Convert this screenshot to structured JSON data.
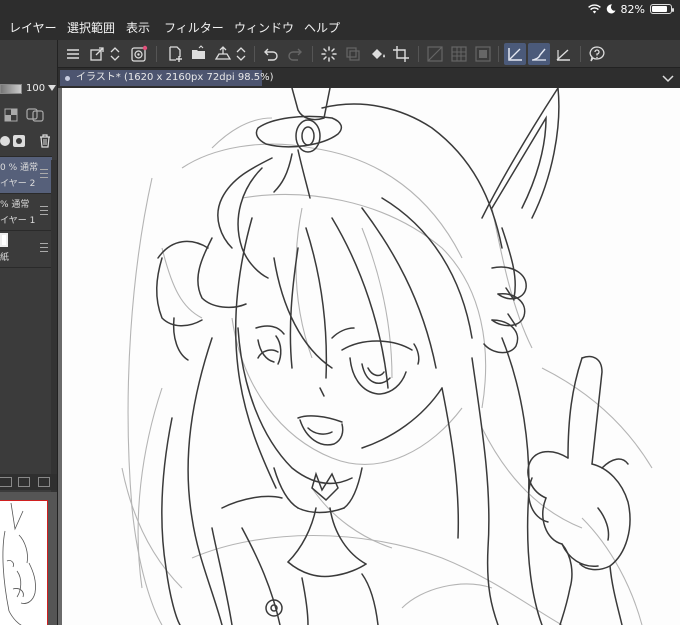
{
  "menubar": {
    "items": [
      "レイヤー",
      "選択範囲",
      "表示",
      "フィルター",
      "ウィンドウ",
      "ヘルプ"
    ]
  },
  "status": {
    "battery_text": "82%",
    "battery_level": 0.82
  },
  "toolbar": {
    "icons": [
      "menu-icon",
      "transform-icon",
      "stepper-icon",
      "record-icon",
      "new-layer-icon",
      "open-icon",
      "export-icon",
      "stepper-icon",
      "undo-icon",
      "redo-icon",
      "loading-icon",
      "clear-icon",
      "fill-icon",
      "crop-icon",
      "snap-off-icon",
      "snap-grid-icon",
      "snap-frame-icon",
      "ruler-snap-icon",
      "special-ruler-icon",
      "perspective-icon",
      "help-icon"
    ]
  },
  "left_panel": {
    "opacity_value": "100",
    "layers": [
      {
        "line1": "0 % 通常",
        "line2": "イヤー 2",
        "selected": true
      },
      {
        "line1": "% 通常",
        "line2": "イヤー 1",
        "selected": false
      },
      {
        "line1": "",
        "line2": "紙",
        "selected": false
      }
    ]
  },
  "document": {
    "tab_title": "イラスト* (1620 x 2160px 72dpi 98.5%)"
  },
  "colors": {
    "accent": "#4d5570",
    "selected_layer": "#56607a",
    "sketch_line": "#3a3a3a",
    "rough_line": "#9a9a9a",
    "navigator_frame": "#d02020"
  }
}
